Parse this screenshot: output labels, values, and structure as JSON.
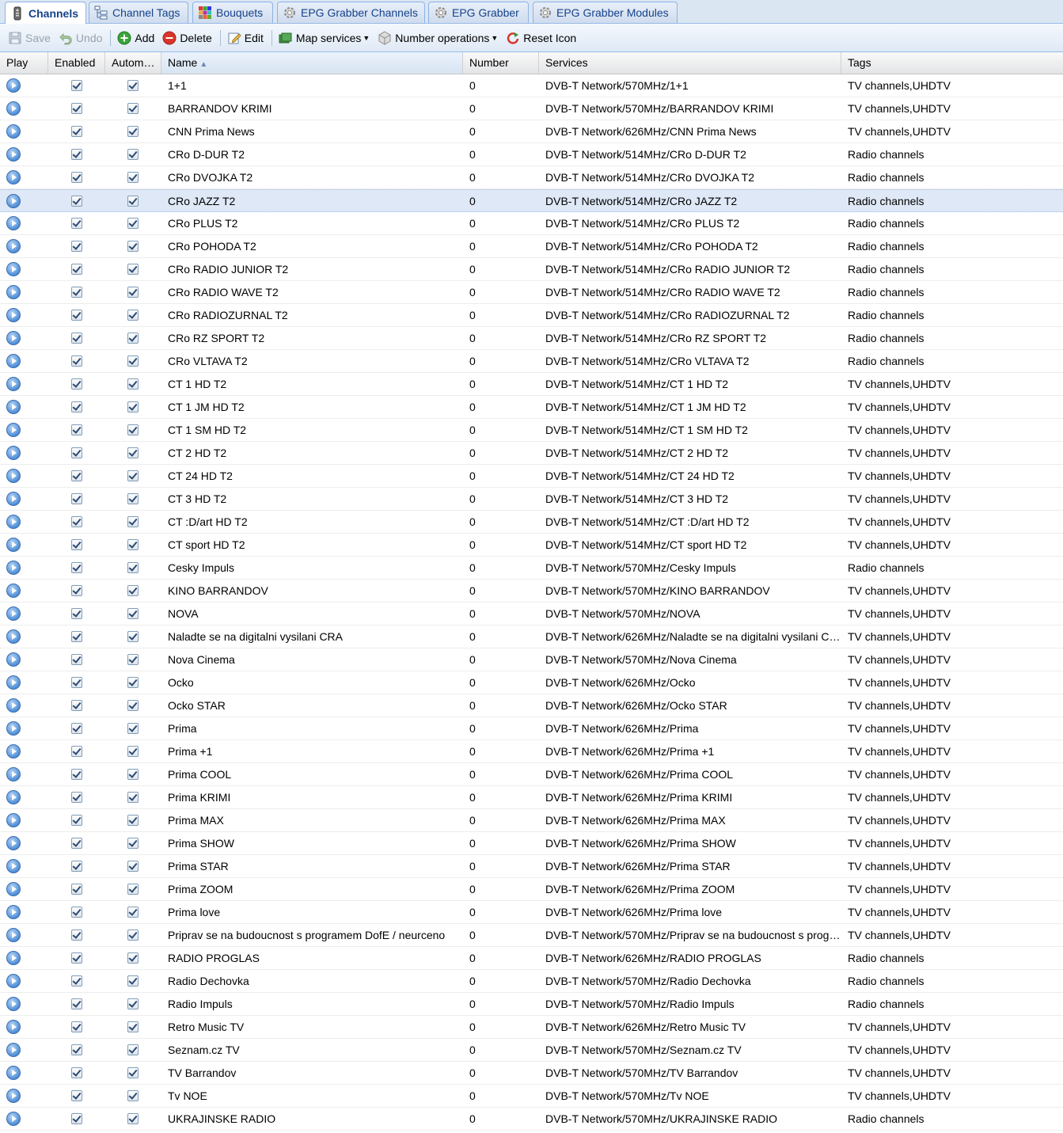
{
  "tabs": [
    {
      "label": "Channels",
      "icon": "remote-control-icon",
      "active": true
    },
    {
      "label": "Channel Tags",
      "icon": "tag-tree-icon",
      "active": false
    },
    {
      "label": "Bouquets",
      "icon": "color-grid-icon",
      "active": false
    },
    {
      "label": "EPG Grabber Channels",
      "icon": "gear-icon",
      "active": false
    },
    {
      "label": "EPG Grabber",
      "icon": "gear-icon",
      "active": false
    },
    {
      "label": "EPG Grabber Modules",
      "icon": "gear-icon",
      "active": false
    }
  ],
  "toolbar": {
    "save": "Save",
    "undo": "Undo",
    "add": "Add",
    "delete": "Delete",
    "edit": "Edit",
    "map_services": "Map services",
    "number_operations": "Number operations",
    "reset_icon": "Reset Icon"
  },
  "columns": {
    "play": "Play",
    "enabled": "Enabled",
    "auto": "Autom…",
    "name": "Name",
    "number": "Number",
    "services": "Services",
    "tags": "Tags"
  },
  "colors": {
    "tab_text": "#15428b",
    "selected_row": "#dfe8f6",
    "add_icon": "#3aa53a",
    "delete_icon": "#d9352b"
  },
  "rows": [
    {
      "name": "1+1",
      "number": "0",
      "services": "DVB-T Network/570MHz/1+1",
      "tags": "TV channels,UHDTV"
    },
    {
      "name": "BARRANDOV KRIMI",
      "number": "0",
      "services": "DVB-T Network/570MHz/BARRANDOV KRIMI",
      "tags": "TV channels,UHDTV"
    },
    {
      "name": "CNN Prima News",
      "number": "0",
      "services": "DVB-T Network/626MHz/CNN Prima News",
      "tags": "TV channels,UHDTV"
    },
    {
      "name": "CRo D-DUR T2",
      "number": "0",
      "services": "DVB-T Network/514MHz/CRo D-DUR T2",
      "tags": "Radio channels"
    },
    {
      "name": "CRo DVOJKA T2",
      "number": "0",
      "services": "DVB-T Network/514MHz/CRo DVOJKA T2",
      "tags": "Radio channels"
    },
    {
      "name": "CRo JAZZ T2",
      "number": "0",
      "services": "DVB-T Network/514MHz/CRo JAZZ T2",
      "tags": "Radio channels",
      "selected": true
    },
    {
      "name": "CRo PLUS T2",
      "number": "0",
      "services": "DVB-T Network/514MHz/CRo PLUS T2",
      "tags": "Radio channels"
    },
    {
      "name": "CRo POHODA T2",
      "number": "0",
      "services": "DVB-T Network/514MHz/CRo POHODA T2",
      "tags": "Radio channels"
    },
    {
      "name": "CRo RADIO JUNIOR T2",
      "number": "0",
      "services": "DVB-T Network/514MHz/CRo RADIO JUNIOR T2",
      "tags": "Radio channels"
    },
    {
      "name": "CRo RADIO WAVE T2",
      "number": "0",
      "services": "DVB-T Network/514MHz/CRo RADIO WAVE T2",
      "tags": "Radio channels"
    },
    {
      "name": "CRo RADIOZURNAL T2",
      "number": "0",
      "services": "DVB-T Network/514MHz/CRo RADIOZURNAL T2",
      "tags": "Radio channels"
    },
    {
      "name": "CRo RZ SPORT T2",
      "number": "0",
      "services": "DVB-T Network/514MHz/CRo RZ SPORT T2",
      "tags": "Radio channels"
    },
    {
      "name": "CRo VLTAVA T2",
      "number": "0",
      "services": "DVB-T Network/514MHz/CRo VLTAVA T2",
      "tags": "Radio channels"
    },
    {
      "name": "CT 1 HD T2",
      "number": "0",
      "services": "DVB-T Network/514MHz/CT 1 HD T2",
      "tags": "TV channels,UHDTV"
    },
    {
      "name": "CT 1 JM HD T2",
      "number": "0",
      "services": "DVB-T Network/514MHz/CT 1 JM HD T2",
      "tags": "TV channels,UHDTV"
    },
    {
      "name": "CT 1 SM HD T2",
      "number": "0",
      "services": "DVB-T Network/514MHz/CT 1 SM HD T2",
      "tags": "TV channels,UHDTV"
    },
    {
      "name": "CT 2 HD T2",
      "number": "0",
      "services": "DVB-T Network/514MHz/CT 2 HD T2",
      "tags": "TV channels,UHDTV"
    },
    {
      "name": "CT 24 HD T2",
      "number": "0",
      "services": "DVB-T Network/514MHz/CT 24 HD T2",
      "tags": "TV channels,UHDTV"
    },
    {
      "name": "CT 3 HD T2",
      "number": "0",
      "services": "DVB-T Network/514MHz/CT 3 HD T2",
      "tags": "TV channels,UHDTV"
    },
    {
      "name": "CT :D/art HD T2",
      "number": "0",
      "services": "DVB-T Network/514MHz/CT :D/art HD T2",
      "tags": "TV channels,UHDTV"
    },
    {
      "name": "CT sport HD T2",
      "number": "0",
      "services": "DVB-T Network/514MHz/CT sport HD T2",
      "tags": "TV channels,UHDTV"
    },
    {
      "name": "Cesky Impuls",
      "number": "0",
      "services": "DVB-T Network/570MHz/Cesky Impuls",
      "tags": "Radio channels"
    },
    {
      "name": "KINO BARRANDOV",
      "number": "0",
      "services": "DVB-T Network/570MHz/KINO BARRANDOV",
      "tags": "TV channels,UHDTV"
    },
    {
      "name": "NOVA",
      "number": "0",
      "services": "DVB-T Network/570MHz/NOVA",
      "tags": "TV channels,UHDTV"
    },
    {
      "name": "Naladte se na digitalni vysilani CRA",
      "number": "0",
      "services": "DVB-T Network/626MHz/Naladte se na digitalni vysilani C…",
      "tags": "TV channels,UHDTV"
    },
    {
      "name": "Nova Cinema",
      "number": "0",
      "services": "DVB-T Network/570MHz/Nova Cinema",
      "tags": "TV channels,UHDTV"
    },
    {
      "name": "Ocko",
      "number": "0",
      "services": "DVB-T Network/626MHz/Ocko",
      "tags": "TV channels,UHDTV"
    },
    {
      "name": "Ocko STAR",
      "number": "0",
      "services": "DVB-T Network/626MHz/Ocko STAR",
      "tags": "TV channels,UHDTV"
    },
    {
      "name": "Prima",
      "number": "0",
      "services": "DVB-T Network/626MHz/Prima",
      "tags": "TV channels,UHDTV"
    },
    {
      "name": "Prima +1",
      "number": "0",
      "services": "DVB-T Network/626MHz/Prima +1",
      "tags": "TV channels,UHDTV"
    },
    {
      "name": "Prima COOL",
      "number": "0",
      "services": "DVB-T Network/626MHz/Prima COOL",
      "tags": "TV channels,UHDTV"
    },
    {
      "name": "Prima KRIMI",
      "number": "0",
      "services": "DVB-T Network/626MHz/Prima KRIMI",
      "tags": "TV channels,UHDTV"
    },
    {
      "name": "Prima MAX",
      "number": "0",
      "services": "DVB-T Network/626MHz/Prima MAX",
      "tags": "TV channels,UHDTV"
    },
    {
      "name": "Prima SHOW",
      "number": "0",
      "services": "DVB-T Network/626MHz/Prima SHOW",
      "tags": "TV channels,UHDTV"
    },
    {
      "name": "Prima STAR",
      "number": "0",
      "services": "DVB-T Network/626MHz/Prima STAR",
      "tags": "TV channels,UHDTV"
    },
    {
      "name": "Prima ZOOM",
      "number": "0",
      "services": "DVB-T Network/626MHz/Prima ZOOM",
      "tags": "TV channels,UHDTV"
    },
    {
      "name": "Prima love",
      "number": "0",
      "services": "DVB-T Network/626MHz/Prima love",
      "tags": "TV channels,UHDTV"
    },
    {
      "name": "Priprav se na budoucnost s programem DofE / neurceno",
      "number": "0",
      "services": "DVB-T Network/570MHz/Priprav se na budoucnost s prog…",
      "tags": "TV channels,UHDTV"
    },
    {
      "name": "RADIO PROGLAS",
      "number": "0",
      "services": "DVB-T Network/626MHz/RADIO PROGLAS",
      "tags": "Radio channels"
    },
    {
      "name": "Radio Dechovka",
      "number": "0",
      "services": "DVB-T Network/570MHz/Radio Dechovka",
      "tags": "Radio channels"
    },
    {
      "name": "Radio Impuls",
      "number": "0",
      "services": "DVB-T Network/570MHz/Radio Impuls",
      "tags": "Radio channels"
    },
    {
      "name": "Retro Music TV",
      "number": "0",
      "services": "DVB-T Network/626MHz/Retro Music TV",
      "tags": "TV channels,UHDTV"
    },
    {
      "name": "Seznam.cz TV",
      "number": "0",
      "services": "DVB-T Network/570MHz/Seznam.cz TV",
      "tags": "TV channels,UHDTV"
    },
    {
      "name": "TV Barrandov",
      "number": "0",
      "services": "DVB-T Network/570MHz/TV Barrandov",
      "tags": "TV channels,UHDTV"
    },
    {
      "name": "Tv NOE",
      "number": "0",
      "services": "DVB-T Network/570MHz/Tv NOE",
      "tags": "TV channels,UHDTV"
    },
    {
      "name": "UKRAJINSKE RADIO",
      "number": "0",
      "services": "DVB-T Network/570MHz/UKRAJINSKE RADIO",
      "tags": "Radio channels"
    }
  ]
}
